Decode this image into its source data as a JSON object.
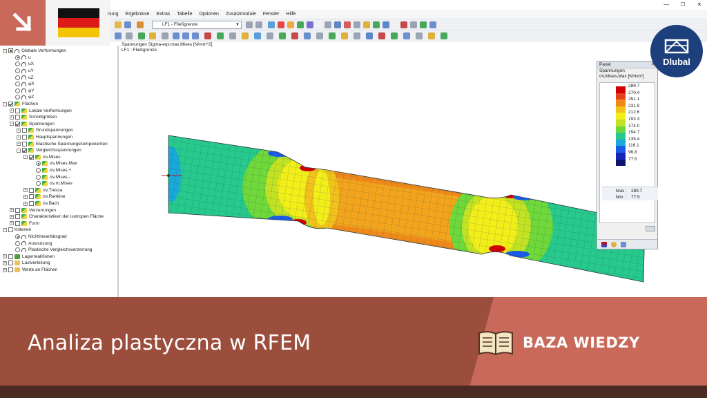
{
  "menu": [
    "nung",
    "Ergebnisse",
    "Extras",
    "Tabelle",
    "Optionen",
    "Zusatzmodule",
    "Fenster",
    "Hilfe"
  ],
  "window_controls": [
    "—",
    "☐",
    "✕"
  ],
  "toolbar": {
    "loadcase": "LF1 - Fließgrenze"
  },
  "logo": {
    "brand": "Dlubal"
  },
  "navigator": [
    {
      "level": 0,
      "exp": "-",
      "ctrl": "chk",
      "state": "partial",
      "icon": "arc",
      "label": "Globale Verformungen"
    },
    {
      "level": 1,
      "ctrl": "radio",
      "state": "on",
      "icon": "arc",
      "label": "u"
    },
    {
      "level": 1,
      "ctrl": "radio",
      "state": "off",
      "icon": "arc",
      "label": "uX"
    },
    {
      "level": 1,
      "ctrl": "radio",
      "state": "off",
      "icon": "arc",
      "label": "uY"
    },
    {
      "level": 1,
      "ctrl": "radio",
      "state": "off",
      "icon": "arc",
      "label": "uZ"
    },
    {
      "level": 1,
      "ctrl": "radio",
      "state": "off",
      "icon": "arc",
      "label": "φX"
    },
    {
      "level": 1,
      "ctrl": "radio",
      "state": "off",
      "icon": "arc",
      "label": "φY"
    },
    {
      "level": 1,
      "ctrl": "radio",
      "state": "off",
      "icon": "arc",
      "label": "φZ"
    },
    {
      "level": 0,
      "exp": "-",
      "ctrl": "chk",
      "state": "on",
      "icon": "surf",
      "label": "Flächen"
    },
    {
      "level": 1,
      "exp": "+",
      "ctrl": "chk",
      "state": "off",
      "icon": "surf",
      "label": "Lokale Verformungen"
    },
    {
      "level": 1,
      "exp": "+",
      "ctrl": "chk",
      "state": "off",
      "icon": "surf",
      "label": "Schnittgrößen"
    },
    {
      "level": 1,
      "exp": "-",
      "ctrl": "chk",
      "state": "on",
      "icon": "surf",
      "label": "Spannungen"
    },
    {
      "level": 2,
      "exp": "+",
      "ctrl": "chk",
      "state": "off",
      "icon": "surf",
      "label": "Grundspannungen"
    },
    {
      "level": 2,
      "exp": "+",
      "ctrl": "chk",
      "state": "off",
      "icon": "surf",
      "label": "Hauptspannungen"
    },
    {
      "level": 2,
      "exp": "+",
      "ctrl": "chk",
      "state": "off",
      "icon": "surf",
      "label": "Elastische Spannungskomponenten"
    },
    {
      "level": 2,
      "exp": "-",
      "ctrl": "chk",
      "state": "on",
      "icon": "surf",
      "label": "Vergleichsspannungen"
    },
    {
      "level": 3,
      "exp": "-",
      "ctrl": "chk",
      "state": "on",
      "icon": "surf",
      "label": "σv,Mises"
    },
    {
      "level": 4,
      "ctrl": "radio",
      "state": "on",
      "icon": "surf",
      "label": "σv,Mises,Max"
    },
    {
      "level": 4,
      "ctrl": "radio",
      "state": "off",
      "icon": "surf",
      "label": "σv,Mises,+"
    },
    {
      "level": 4,
      "ctrl": "radio",
      "state": "off",
      "icon": "surf",
      "label": "σv,Mises,-"
    },
    {
      "level": 4,
      "ctrl": "radio",
      "state": "off",
      "icon": "surf",
      "label": "σv,m,Mises"
    },
    {
      "level": 3,
      "exp": "+",
      "ctrl": "chk",
      "state": "off",
      "icon": "surf",
      "label": "σv,Tresca"
    },
    {
      "level": 3,
      "exp": "+",
      "ctrl": "chk",
      "state": "off",
      "icon": "surf",
      "label": "σv,Rankine"
    },
    {
      "level": 3,
      "exp": "+",
      "ctrl": "chk",
      "state": "off",
      "icon": "surf",
      "label": "σv,Bach"
    },
    {
      "level": 1,
      "exp": "+",
      "ctrl": "chk",
      "state": "off",
      "icon": "surf",
      "label": "Verzerrungen"
    },
    {
      "level": 1,
      "exp": "+",
      "ctrl": "chk",
      "state": "off",
      "icon": "surf",
      "label": "Charakteristiken der isotropen Fläche"
    },
    {
      "level": 1,
      "exp": "+",
      "ctrl": "chk",
      "state": "off",
      "icon": "surf",
      "label": "Form"
    },
    {
      "level": 0,
      "exp": "-",
      "ctrl": "chk",
      "state": "off",
      "icon": "none",
      "label": "Kriterien"
    },
    {
      "level": 1,
      "ctrl": "radio",
      "state": "on",
      "icon": "arc",
      "label": "Nichtlinearitätsgrad"
    },
    {
      "level": 1,
      "ctrl": "radio",
      "state": "off",
      "icon": "arc",
      "label": "Ausnutzung"
    },
    {
      "level": 1,
      "ctrl": "radio",
      "state": "off",
      "icon": "arc",
      "label": "Plastische Vergleichsverzerrung"
    },
    {
      "level": 0,
      "exp": "+",
      "ctrl": "chk",
      "state": "off",
      "icon": "green",
      "label": "Lagerreaktionen"
    },
    {
      "level": 0,
      "exp": "+",
      "ctrl": "chk",
      "state": "off",
      "icon": "folder",
      "label": "Lastverteilung"
    },
    {
      "level": 0,
      "exp": "+",
      "ctrl": "chk",
      "state": "off",
      "icon": "folder",
      "label": "Werte an Flächen"
    }
  ],
  "view": {
    "line1": "Spannungen Sigma-eqv,max,Mises [N/mm^2]",
    "line2": "LF1 : Fließgrenze"
  },
  "panel": {
    "title": "Panel",
    "close": "✕",
    "section": "Spannungen",
    "quantity": "σv,Mises,Max [N/mm²]",
    "scale": [
      {
        "value": "289.7",
        "color": "#d40000"
      },
      {
        "value": "270.4",
        "color": "#e8401e"
      },
      {
        "value": "251.1",
        "color": "#ef8a1a"
      },
      {
        "value": "231.9",
        "color": "#f2c21c"
      },
      {
        "value": "212.6",
        "color": "#f2ee1a"
      },
      {
        "value": "193.3",
        "color": "#c2e224"
      },
      {
        "value": "174.0",
        "color": "#6fd83a"
      },
      {
        "value": "154.7",
        "color": "#27c98c"
      },
      {
        "value": "135.4",
        "color": "#1aa9d8"
      },
      {
        "value": "116.1",
        "color": "#1a5be8"
      },
      {
        "value": "96.8",
        "color": "#1726b8"
      },
      {
        "value": "77.5",
        "color": "#0d1470"
      }
    ],
    "max_label": "Max",
    "min_label": "Min",
    "separator": ":",
    "max_value": "289.7",
    "min_value": "77.5"
  },
  "banner": {
    "title": "Analiza plastyczna w RFEM",
    "knowledge_base": "BAZA WIEDZY"
  },
  "colors": {
    "banner_dark": "#9c4e3d",
    "banner_light": "#c8695a",
    "dlubal_blue": "#1d3f7b"
  }
}
